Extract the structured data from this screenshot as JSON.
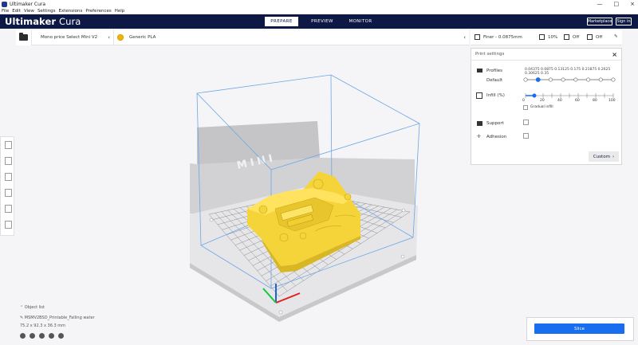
{
  "window": {
    "title": "Ultimaker Cura",
    "controls": [
      "—",
      "□",
      "×"
    ]
  },
  "menu": [
    "File",
    "Edit",
    "View",
    "Settings",
    "Extensions",
    "Preferences",
    "Help"
  ],
  "header": {
    "brand_bold": "Ultimaker",
    "brand_light": "Cura",
    "tabs": [
      "PREPARE",
      "PREVIEW",
      "MONITOR"
    ],
    "active_tab": "PREPARE",
    "marketplace": "Marketplace",
    "signin": "Sign in"
  },
  "toolbar": {
    "printer": "Mono price Select Mini V2",
    "material": "Generic PLA",
    "profile": "Finer - 0.0875mm",
    "infill": "10%",
    "support": "Off",
    "adhesion": "Off"
  },
  "print_settings": {
    "title": "Print settings",
    "close": "×",
    "profiles_label": "Profiles",
    "profiles_default": "Default",
    "layer_heights": "0.04375 0.0875 0.13125 0.175 0.21875 0.2625 0.30625 0.35",
    "layer_height_count": 8,
    "selected_layer_index": 1,
    "infill_label": "Infill (%)",
    "infill_ticks": [
      "0",
      "20",
      "40",
      "60",
      "80",
      "100"
    ],
    "infill_value": 10,
    "gradual_infill_label": "Gradual infill",
    "support_label": "Support",
    "adhesion_label": "Adhesion",
    "custom_button": "Custom"
  },
  "viewport": {
    "printer_label": "MINI"
  },
  "object_info": {
    "object_list": "Object list",
    "filename": "MSMV2BSD_Printable_Falling water",
    "dimensions": "75.2 x 92.3 x 36.3 mm"
  },
  "slice": {
    "button": "Slice"
  },
  "colors": {
    "header": "#0d1844",
    "accent": "#196ef0",
    "model": "#f5d43a",
    "build_volume": "#6ca6e6"
  }
}
